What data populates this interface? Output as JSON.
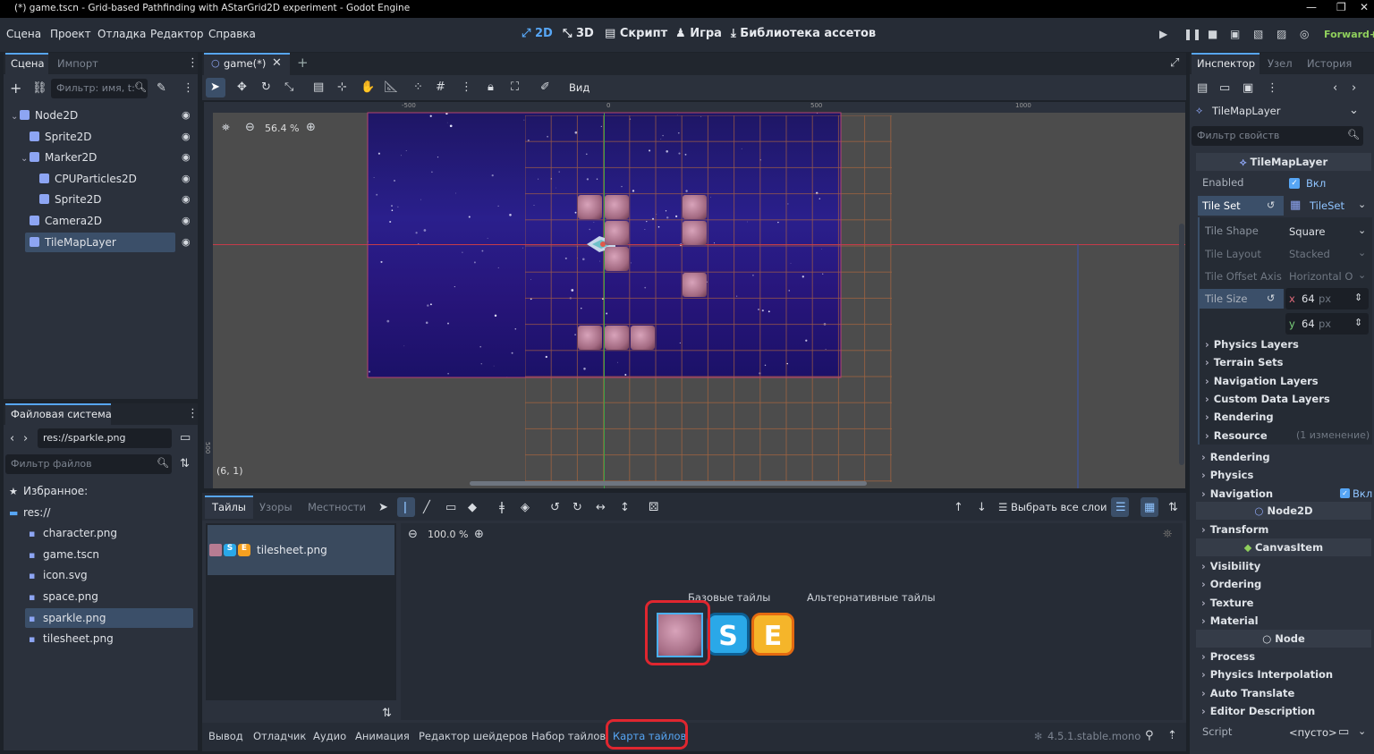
{
  "window": {
    "title": "(*) game.tscn - Grid-based Pathfinding with AStarGrid2D experiment - Godot Engine",
    "min": "—",
    "max": "❐",
    "close": "✕"
  },
  "menu": [
    "Сцена",
    "Проект",
    "Отладка",
    "Редактор",
    "Справка"
  ],
  "workspaces": [
    "2D",
    "3D",
    "Скрипт",
    "Игра",
    "Библиотека ассетов"
  ],
  "renderer": "Forward+",
  "scene_dock": {
    "tabs": [
      "Сцена",
      "Импорт"
    ],
    "filter_placeholder": "Фильтр: имя, t:",
    "nodes": [
      {
        "label": "Node2D",
        "color": "#8da5f3",
        "depth": 0,
        "arrow": "⌄"
      },
      {
        "label": "Sprite2D",
        "color": "#8da5f3",
        "depth": 1,
        "arrow": ""
      },
      {
        "label": "Marker2D",
        "color": "#8da5f3",
        "depth": 1,
        "arrow": "⌄"
      },
      {
        "label": "CPUParticles2D",
        "color": "#8da5f3",
        "depth": 2,
        "arrow": ""
      },
      {
        "label": "Sprite2D",
        "color": "#8da5f3",
        "depth": 2,
        "arrow": ""
      },
      {
        "label": "Camera2D",
        "color": "#8da5f3",
        "depth": 1,
        "arrow": ""
      },
      {
        "label": "TileMapLayer",
        "color": "#8da5f3",
        "depth": 1,
        "arrow": "",
        "selected": true
      }
    ]
  },
  "filesystem": {
    "title": "Файловая система",
    "path": "res://sparkle.png",
    "filter_placeholder": "Фильтр файлов",
    "items": [
      {
        "label": "Избранное:",
        "type": "fav",
        "depth": 0
      },
      {
        "label": "res://",
        "type": "folder",
        "depth": 0
      },
      {
        "label": "character.png",
        "type": "file",
        "depth": 1
      },
      {
        "label": "game.tscn",
        "type": "file",
        "depth": 1
      },
      {
        "label": "icon.svg",
        "type": "file",
        "depth": 1
      },
      {
        "label": "space.png",
        "type": "file",
        "depth": 1
      },
      {
        "label": "sparkle.png",
        "type": "file",
        "depth": 1,
        "selected": true
      },
      {
        "label": "tilesheet.png",
        "type": "file",
        "depth": 1
      }
    ]
  },
  "editor": {
    "tab": "game(*)",
    "view_menu": "Вид",
    "zoom": "56.4 %",
    "coords": "(6, 1)",
    "ruler_labels": [
      "-500",
      "0",
      "500",
      "1000"
    ],
    "ruler_side": "500"
  },
  "tilemap_panel": {
    "tabs": [
      "Тайлы",
      "Узоры",
      "Местности"
    ],
    "select_all_layers": "Выбрать все слои",
    "tileset_item": "tilesheet.png",
    "zoom": "100.0 %",
    "base_tiles": "Базовые тайлы",
    "alt_tiles": "Альтернативные тайлы"
  },
  "bottom_tabs": [
    "Вывод",
    "Отладчик",
    "Аудио",
    "Анимация",
    "Редактор шейдеров",
    "Набор тайлов",
    "Карта тайлов"
  ],
  "version": "4.5.1.stable.mono",
  "inspector": {
    "tabs": [
      "Инспектор",
      "Узел",
      "История"
    ],
    "object": "TileMapLayer",
    "filter_placeholder": "Фильтр свойств",
    "class_header": "TileMapLayer",
    "enabled_label": "Enabled",
    "enabled_value": "Вкл",
    "tileset_label": "Tile Set",
    "tileset_value": "TileSet",
    "tile_shape_label": "Tile Shape",
    "tile_shape_value": "Square",
    "tile_layout_label": "Tile Layout",
    "tile_layout_value": "Stacked",
    "tile_offset_label": "Tile Offset Axis",
    "tile_offset_value": "Horizontal O",
    "tile_size_label": "Tile Size",
    "tile_size_x": "64",
    "tile_size_y": "64",
    "unit": "px",
    "x": "x",
    "y": "y",
    "tileset_sections": [
      "Physics Layers",
      "Terrain Sets",
      "Navigation Layers",
      "Custom Data Layers",
      "Rendering",
      "Resource"
    ],
    "resource_note": "(1 изменение)",
    "sections_a": [
      "Rendering",
      "Physics",
      "Navigation"
    ],
    "navigation_value": "Вкл",
    "node2d_header": "Node2D",
    "sections_b": [
      "Transform"
    ],
    "canvasitem_header": "CanvasItem",
    "sections_c": [
      "Visibility",
      "Ordering",
      "Texture",
      "Material"
    ],
    "node_header": "Node",
    "sections_d": [
      "Process",
      "Physics Interpolation",
      "Auto Translate",
      "Editor Description"
    ],
    "script_label": "Script",
    "script_value": "<пусто>"
  },
  "colors": {
    "accent": "#57a6f5",
    "highlight": "#e0262f"
  }
}
